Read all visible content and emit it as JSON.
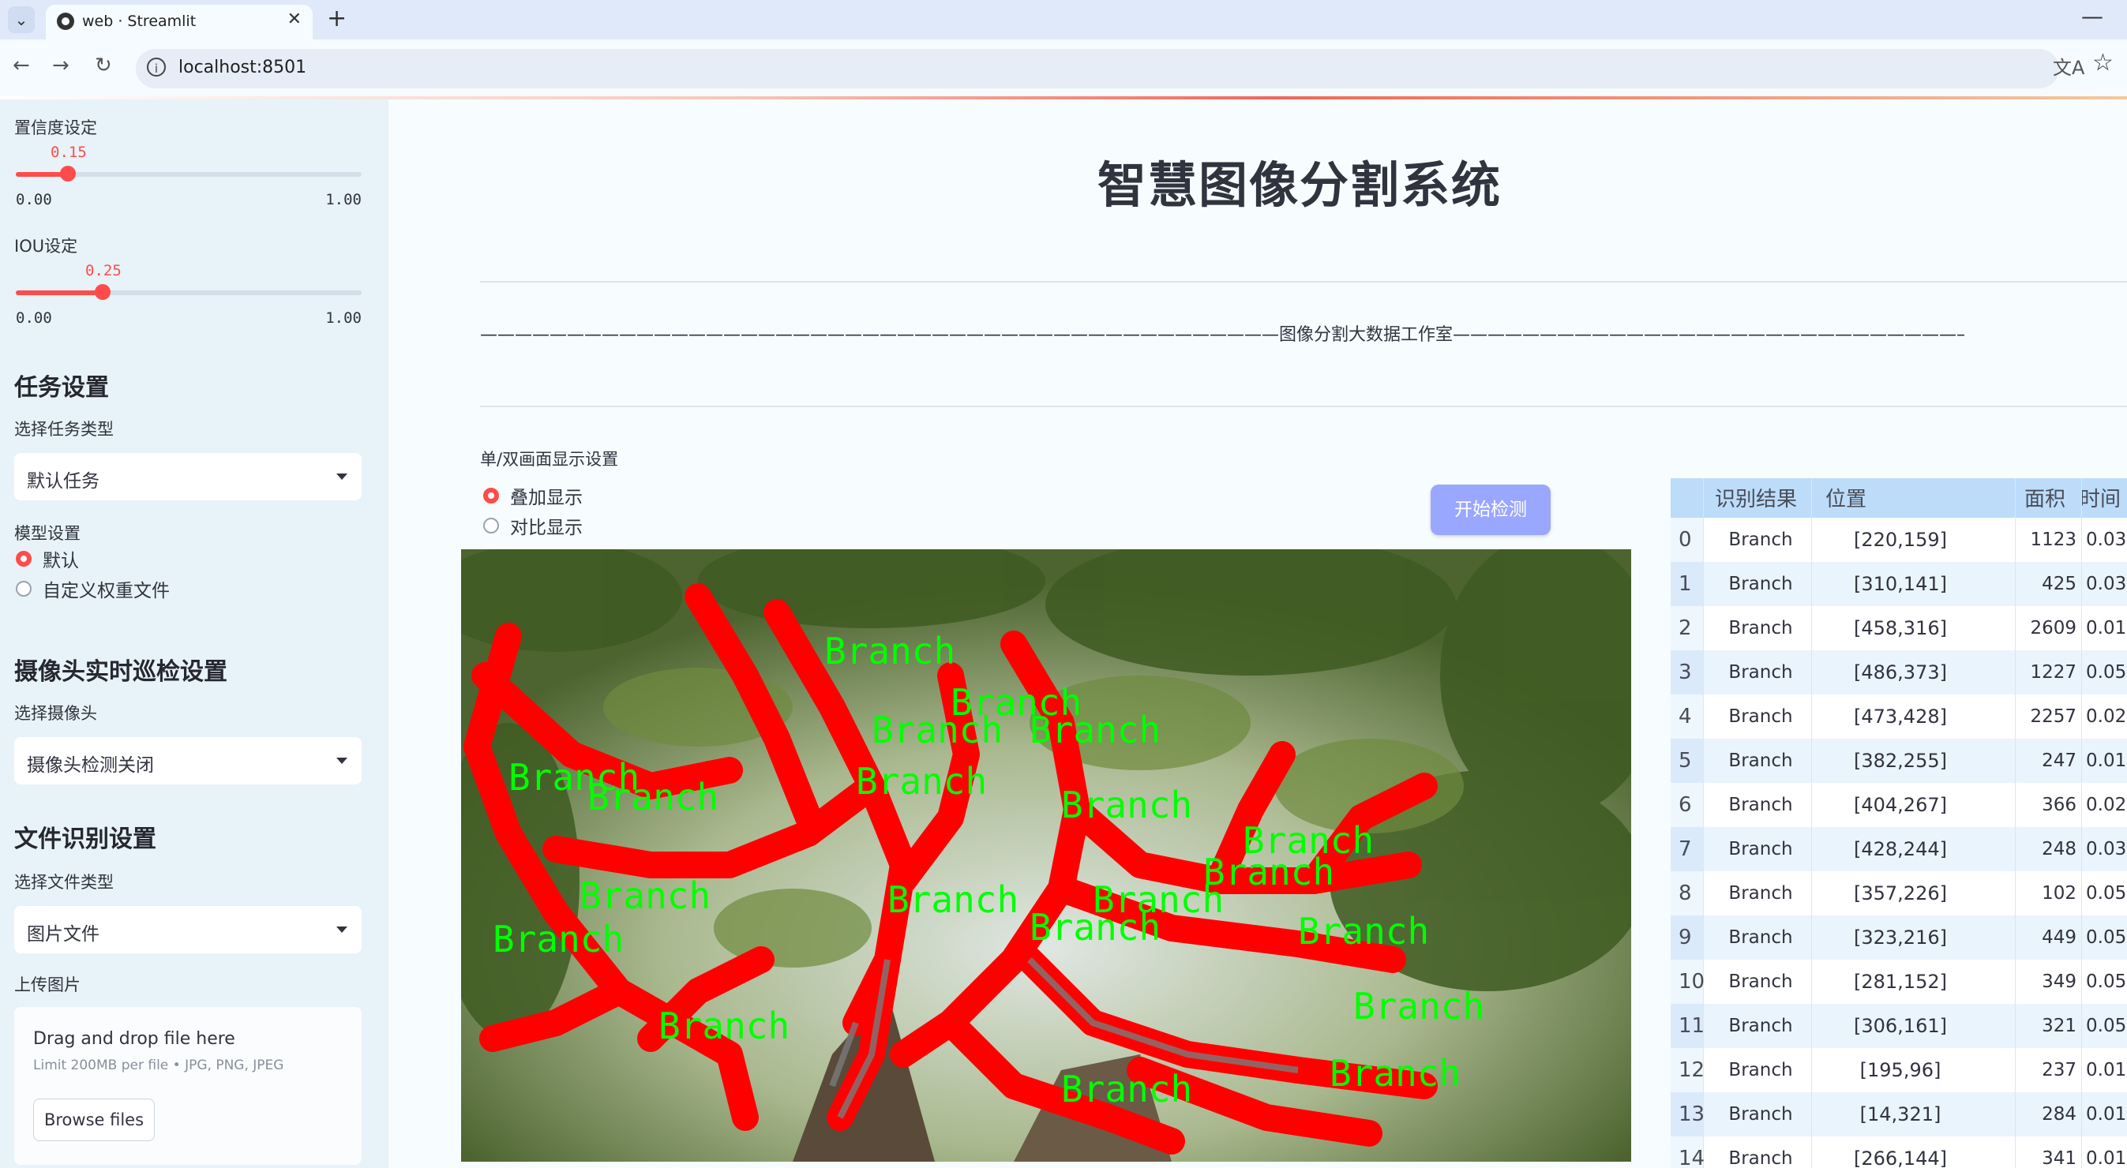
{
  "browser": {
    "tab_title": "web · Streamlit",
    "url": "localhost:8501",
    "new_tab": "+",
    "close_tab": "✕"
  },
  "sidebar": {
    "confidence": {
      "label": "置信度设定",
      "value": "0.15",
      "min": "0.00",
      "max": "1.00",
      "fraction": 0.15
    },
    "iou": {
      "label": "IOU设定",
      "value": "0.25",
      "min": "0.00",
      "max": "1.00",
      "fraction": 0.25
    },
    "task_section": "任务设置",
    "task_type_label": "选择任务类型",
    "task_type_value": "默认任务",
    "model_label": "模型设置",
    "model_options": [
      "默认",
      "自定义权重文件"
    ],
    "model_selected": 0,
    "camera_section": "摄像头实时巡检设置",
    "camera_label": "选择摄像头",
    "camera_value": "摄像头检测关闭",
    "file_section": "文件识别设置",
    "file_type_label": "选择文件类型",
    "file_type_value": "图片文件",
    "upload_label": "上传图片",
    "upload_title": "Drag and drop file here",
    "upload_limit": "Limit 200MB per file • JPG, PNG, JPEG",
    "browse_button": "Browse files"
  },
  "main": {
    "title": "智慧图像分割系统",
    "studio_line": "——————————————————————————————————————————————图像分割大数据工作室——————————————————————————————————————————————",
    "display_mode_label": "单/双画面显示设置",
    "display_options": [
      "叠加显示",
      "对比显示"
    ],
    "display_selected": 0,
    "start_button": "开始检测",
    "detection_label": "Branch"
  },
  "table": {
    "headers": [
      "识别结果",
      "位置",
      "面积",
      "时间"
    ],
    "rows": [
      {
        "idx": "0",
        "name": "Branch",
        "pos": "[220,159]",
        "area": "1123",
        "time": "0.03"
      },
      {
        "idx": "1",
        "name": "Branch",
        "pos": "[310,141]",
        "area": "425",
        "time": "0.03"
      },
      {
        "idx": "2",
        "name": "Branch",
        "pos": "[458,316]",
        "area": "2609",
        "time": "0.01"
      },
      {
        "idx": "3",
        "name": "Branch",
        "pos": "[486,373]",
        "area": "1227",
        "time": "0.05"
      },
      {
        "idx": "4",
        "name": "Branch",
        "pos": "[473,428]",
        "area": "2257",
        "time": "0.02"
      },
      {
        "idx": "5",
        "name": "Branch",
        "pos": "[382,255]",
        "area": "247",
        "time": "0.01"
      },
      {
        "idx": "6",
        "name": "Branch",
        "pos": "[404,267]",
        "area": "366",
        "time": "0.02"
      },
      {
        "idx": "7",
        "name": "Branch",
        "pos": "[428,244]",
        "area": "248",
        "time": "0.03"
      },
      {
        "idx": "8",
        "name": "Branch",
        "pos": "[357,226]",
        "area": "102",
        "time": "0.05"
      },
      {
        "idx": "9",
        "name": "Branch",
        "pos": "[323,216]",
        "area": "449",
        "time": "0.05"
      },
      {
        "idx": "10",
        "name": "Branch",
        "pos": "[281,152]",
        "area": "349",
        "time": "0.05"
      },
      {
        "idx": "11",
        "name": "Branch",
        "pos": "[306,161]",
        "area": "321",
        "time": "0.05"
      },
      {
        "idx": "12",
        "name": "Branch",
        "pos": "[195,96]",
        "area": "237",
        "time": "0.01"
      },
      {
        "idx": "13",
        "name": "Branch",
        "pos": "[14,321]",
        "area": "284",
        "time": "0.01"
      },
      {
        "idx": "14",
        "name": "Branch",
        "pos": "[266,144]",
        "area": "341",
        "time": "0.01"
      }
    ]
  },
  "colors": {
    "accent": "#ff4b4b",
    "mask": "#ff0000",
    "label_text": "#00ff00",
    "button": "#9aa7ff",
    "table_header": "#bcdcfa"
  }
}
